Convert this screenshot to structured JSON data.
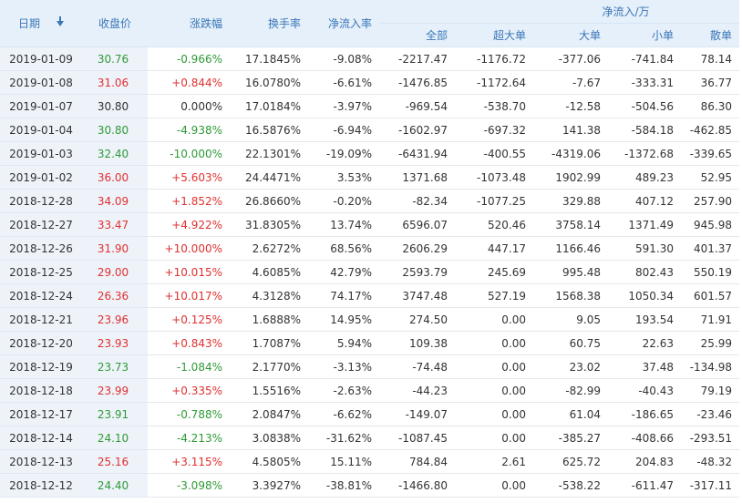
{
  "headers": {
    "date": "日期",
    "close": "收盘价",
    "change": "涨跌幅",
    "turnover": "换手率",
    "net_rate": "净流入率",
    "group": "净流入/万",
    "all": "全部",
    "super": "超大单",
    "big": "大单",
    "small": "小单",
    "retail": "散单"
  },
  "rows": [
    {
      "date": "2019-01-09",
      "close": "30.76",
      "change": "-0.966%",
      "turnover": "17.1845%",
      "net_rate": "-9.08%",
      "all": "-2217.47",
      "super": "-1176.72",
      "big": "-377.06",
      "small": "-741.84",
      "retail": "78.14",
      "dir": "down"
    },
    {
      "date": "2019-01-08",
      "close": "31.06",
      "change": "+0.844%",
      "turnover": "16.0780%",
      "net_rate": "-6.61%",
      "all": "-1476.85",
      "super": "-1172.64",
      "big": "-7.67",
      "small": "-333.31",
      "retail": "36.77",
      "dir": "up"
    },
    {
      "date": "2019-01-07",
      "close": "30.80",
      "change": "0.000%",
      "turnover": "17.0184%",
      "net_rate": "-3.97%",
      "all": "-969.54",
      "super": "-538.70",
      "big": "-12.58",
      "small": "-504.56",
      "retail": "86.30",
      "dir": "flat"
    },
    {
      "date": "2019-01-04",
      "close": "30.80",
      "change": "-4.938%",
      "turnover": "16.5876%",
      "net_rate": "-6.94%",
      "all": "-1602.97",
      "super": "-697.32",
      "big": "141.38",
      "small": "-584.18",
      "retail": "-462.85",
      "dir": "down"
    },
    {
      "date": "2019-01-03",
      "close": "32.40",
      "change": "-10.000%",
      "turnover": "22.1301%",
      "net_rate": "-19.09%",
      "all": "-6431.94",
      "super": "-400.55",
      "big": "-4319.06",
      "small": "-1372.68",
      "retail": "-339.65",
      "dir": "down"
    },
    {
      "date": "2019-01-02",
      "close": "36.00",
      "change": "+5.603%",
      "turnover": "24.4471%",
      "net_rate": "3.53%",
      "all": "1371.68",
      "super": "-1073.48",
      "big": "1902.99",
      "small": "489.23",
      "retail": "52.95",
      "dir": "up"
    },
    {
      "date": "2018-12-28",
      "close": "34.09",
      "change": "+1.852%",
      "turnover": "26.8660%",
      "net_rate": "-0.20%",
      "all": "-82.34",
      "super": "-1077.25",
      "big": "329.88",
      "small": "407.12",
      "retail": "257.90",
      "dir": "up"
    },
    {
      "date": "2018-12-27",
      "close": "33.47",
      "change": "+4.922%",
      "turnover": "31.8305%",
      "net_rate": "13.74%",
      "all": "6596.07",
      "super": "520.46",
      "big": "3758.14",
      "small": "1371.49",
      "retail": "945.98",
      "dir": "up"
    },
    {
      "date": "2018-12-26",
      "close": "31.90",
      "change": "+10.000%",
      "turnover": "2.6272%",
      "net_rate": "68.56%",
      "all": "2606.29",
      "super": "447.17",
      "big": "1166.46",
      "small": "591.30",
      "retail": "401.37",
      "dir": "up"
    },
    {
      "date": "2018-12-25",
      "close": "29.00",
      "change": "+10.015%",
      "turnover": "4.6085%",
      "net_rate": "42.79%",
      "all": "2593.79",
      "super": "245.69",
      "big": "995.48",
      "small": "802.43",
      "retail": "550.19",
      "dir": "up"
    },
    {
      "date": "2018-12-24",
      "close": "26.36",
      "change": "+10.017%",
      "turnover": "4.3128%",
      "net_rate": "74.17%",
      "all": "3747.48",
      "super": "527.19",
      "big": "1568.38",
      "small": "1050.34",
      "retail": "601.57",
      "dir": "up"
    },
    {
      "date": "2018-12-21",
      "close": "23.96",
      "change": "+0.125%",
      "turnover": "1.6888%",
      "net_rate": "14.95%",
      "all": "274.50",
      "super": "0.00",
      "big": "9.05",
      "small": "193.54",
      "retail": "71.91",
      "dir": "up"
    },
    {
      "date": "2018-12-20",
      "close": "23.93",
      "change": "+0.843%",
      "turnover": "1.7087%",
      "net_rate": "5.94%",
      "all": "109.38",
      "super": "0.00",
      "big": "60.75",
      "small": "22.63",
      "retail": "25.99",
      "dir": "up"
    },
    {
      "date": "2018-12-19",
      "close": "23.73",
      "change": "-1.084%",
      "turnover": "2.1770%",
      "net_rate": "-3.13%",
      "all": "-74.48",
      "super": "0.00",
      "big": "23.02",
      "small": "37.48",
      "retail": "-134.98",
      "dir": "down"
    },
    {
      "date": "2018-12-18",
      "close": "23.99",
      "change": "+0.335%",
      "turnover": "1.5516%",
      "net_rate": "-2.63%",
      "all": "-44.23",
      "super": "0.00",
      "big": "-82.99",
      "small": "-40.43",
      "retail": "79.19",
      "dir": "up"
    },
    {
      "date": "2018-12-17",
      "close": "23.91",
      "change": "-0.788%",
      "turnover": "2.0847%",
      "net_rate": "-6.62%",
      "all": "-149.07",
      "super": "0.00",
      "big": "61.04",
      "small": "-186.65",
      "retail": "-23.46",
      "dir": "down"
    },
    {
      "date": "2018-12-14",
      "close": "24.10",
      "change": "-4.213%",
      "turnover": "3.0838%",
      "net_rate": "-31.62%",
      "all": "-1087.45",
      "super": "0.00",
      "big": "-385.27",
      "small": "-408.66",
      "retail": "-293.51",
      "dir": "down"
    },
    {
      "date": "2018-12-13",
      "close": "25.16",
      "change": "+3.115%",
      "turnover": "4.5805%",
      "net_rate": "15.11%",
      "all": "784.84",
      "super": "2.61",
      "big": "625.72",
      "small": "204.83",
      "retail": "-48.32",
      "dir": "up"
    },
    {
      "date": "2018-12-12",
      "close": "24.40",
      "change": "-3.098%",
      "turnover": "3.3927%",
      "net_rate": "-38.81%",
      "all": "-1466.80",
      "super": "0.00",
      "big": "-538.22",
      "small": "-611.47",
      "retail": "-317.11",
      "dir": "down"
    }
  ],
  "colors": {
    "up": "#e03131",
    "down": "#2f9a38",
    "header_text": "#3a76b8",
    "header_bg": "#e6f0fa",
    "side_bg": "#eef3fa"
  }
}
